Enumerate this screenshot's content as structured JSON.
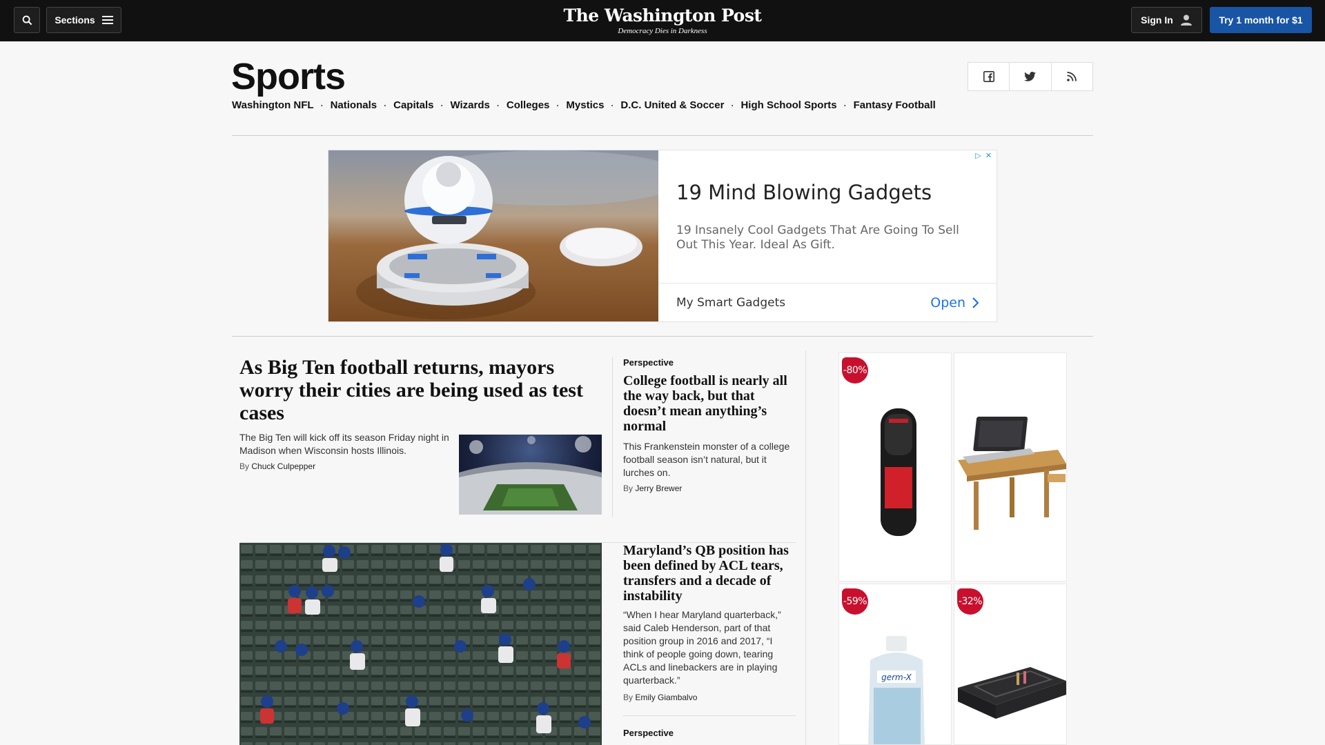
{
  "topbar": {
    "sections_label": "Sections",
    "logo": "The Washington Post",
    "tagline": "Democracy Dies in Darkness",
    "signin_label": "Sign In",
    "subscribe_label": "Try 1 month for $1"
  },
  "section": {
    "title": "Sports",
    "subnav": [
      "Washington NFL",
      "Nationals",
      "Capitals",
      "Wizards",
      "Colleges",
      "Mystics",
      "D.C. United & Soccer",
      "High School Sports",
      "Fantasy Football"
    ],
    "social": [
      "facebook-icon",
      "twitter-icon",
      "rss-icon"
    ]
  },
  "banner_ad": {
    "title": "19 Mind Blowing Gadgets",
    "description": "19 Insanely Cool Gadgets That Are Going To Sell Out This Year. Ideal As Gift.",
    "brand": "My Smart Gadgets",
    "cta": "Open"
  },
  "articles": [
    {
      "headline": "As Big Ten football returns, mayors worry their cities are being used as test cases",
      "blurb": "The Big Ten will kick off its season Friday night in Madison when Wisconsin hosts Illinois.",
      "by": "By",
      "author": "Chuck Culpepper"
    },
    {
      "kicker": "Perspective",
      "headline": "College football is nearly all the way back, but that doesn’t mean anything’s normal",
      "blurb": "This Frankenstein monster of a college football season isn’t natural, but it lurches on.",
      "by": "By",
      "author": "Jerry Brewer"
    },
    {
      "headline": "Maryland’s QB position has been defined by ACL tears, transfers and a decade of instability",
      "blurb": "“When I hear Maryland quarterback,” said Caleb Henderson, part of that position group in 2016 and 2017, “I think of people going down, tearing ACLs and linebackers are in playing quarterback.”",
      "by": "By",
      "author": "Emily Giambalvo"
    },
    {
      "kicker": "Perspective"
    }
  ],
  "rail_ad": {
    "badges": [
      "-80%",
      "-59%",
      "-32%"
    ]
  },
  "colors": {
    "topbar": "#111111",
    "subscribe": "#1955a5",
    "badge": "#c8102e",
    "ad_cta": "#1a73e8"
  }
}
